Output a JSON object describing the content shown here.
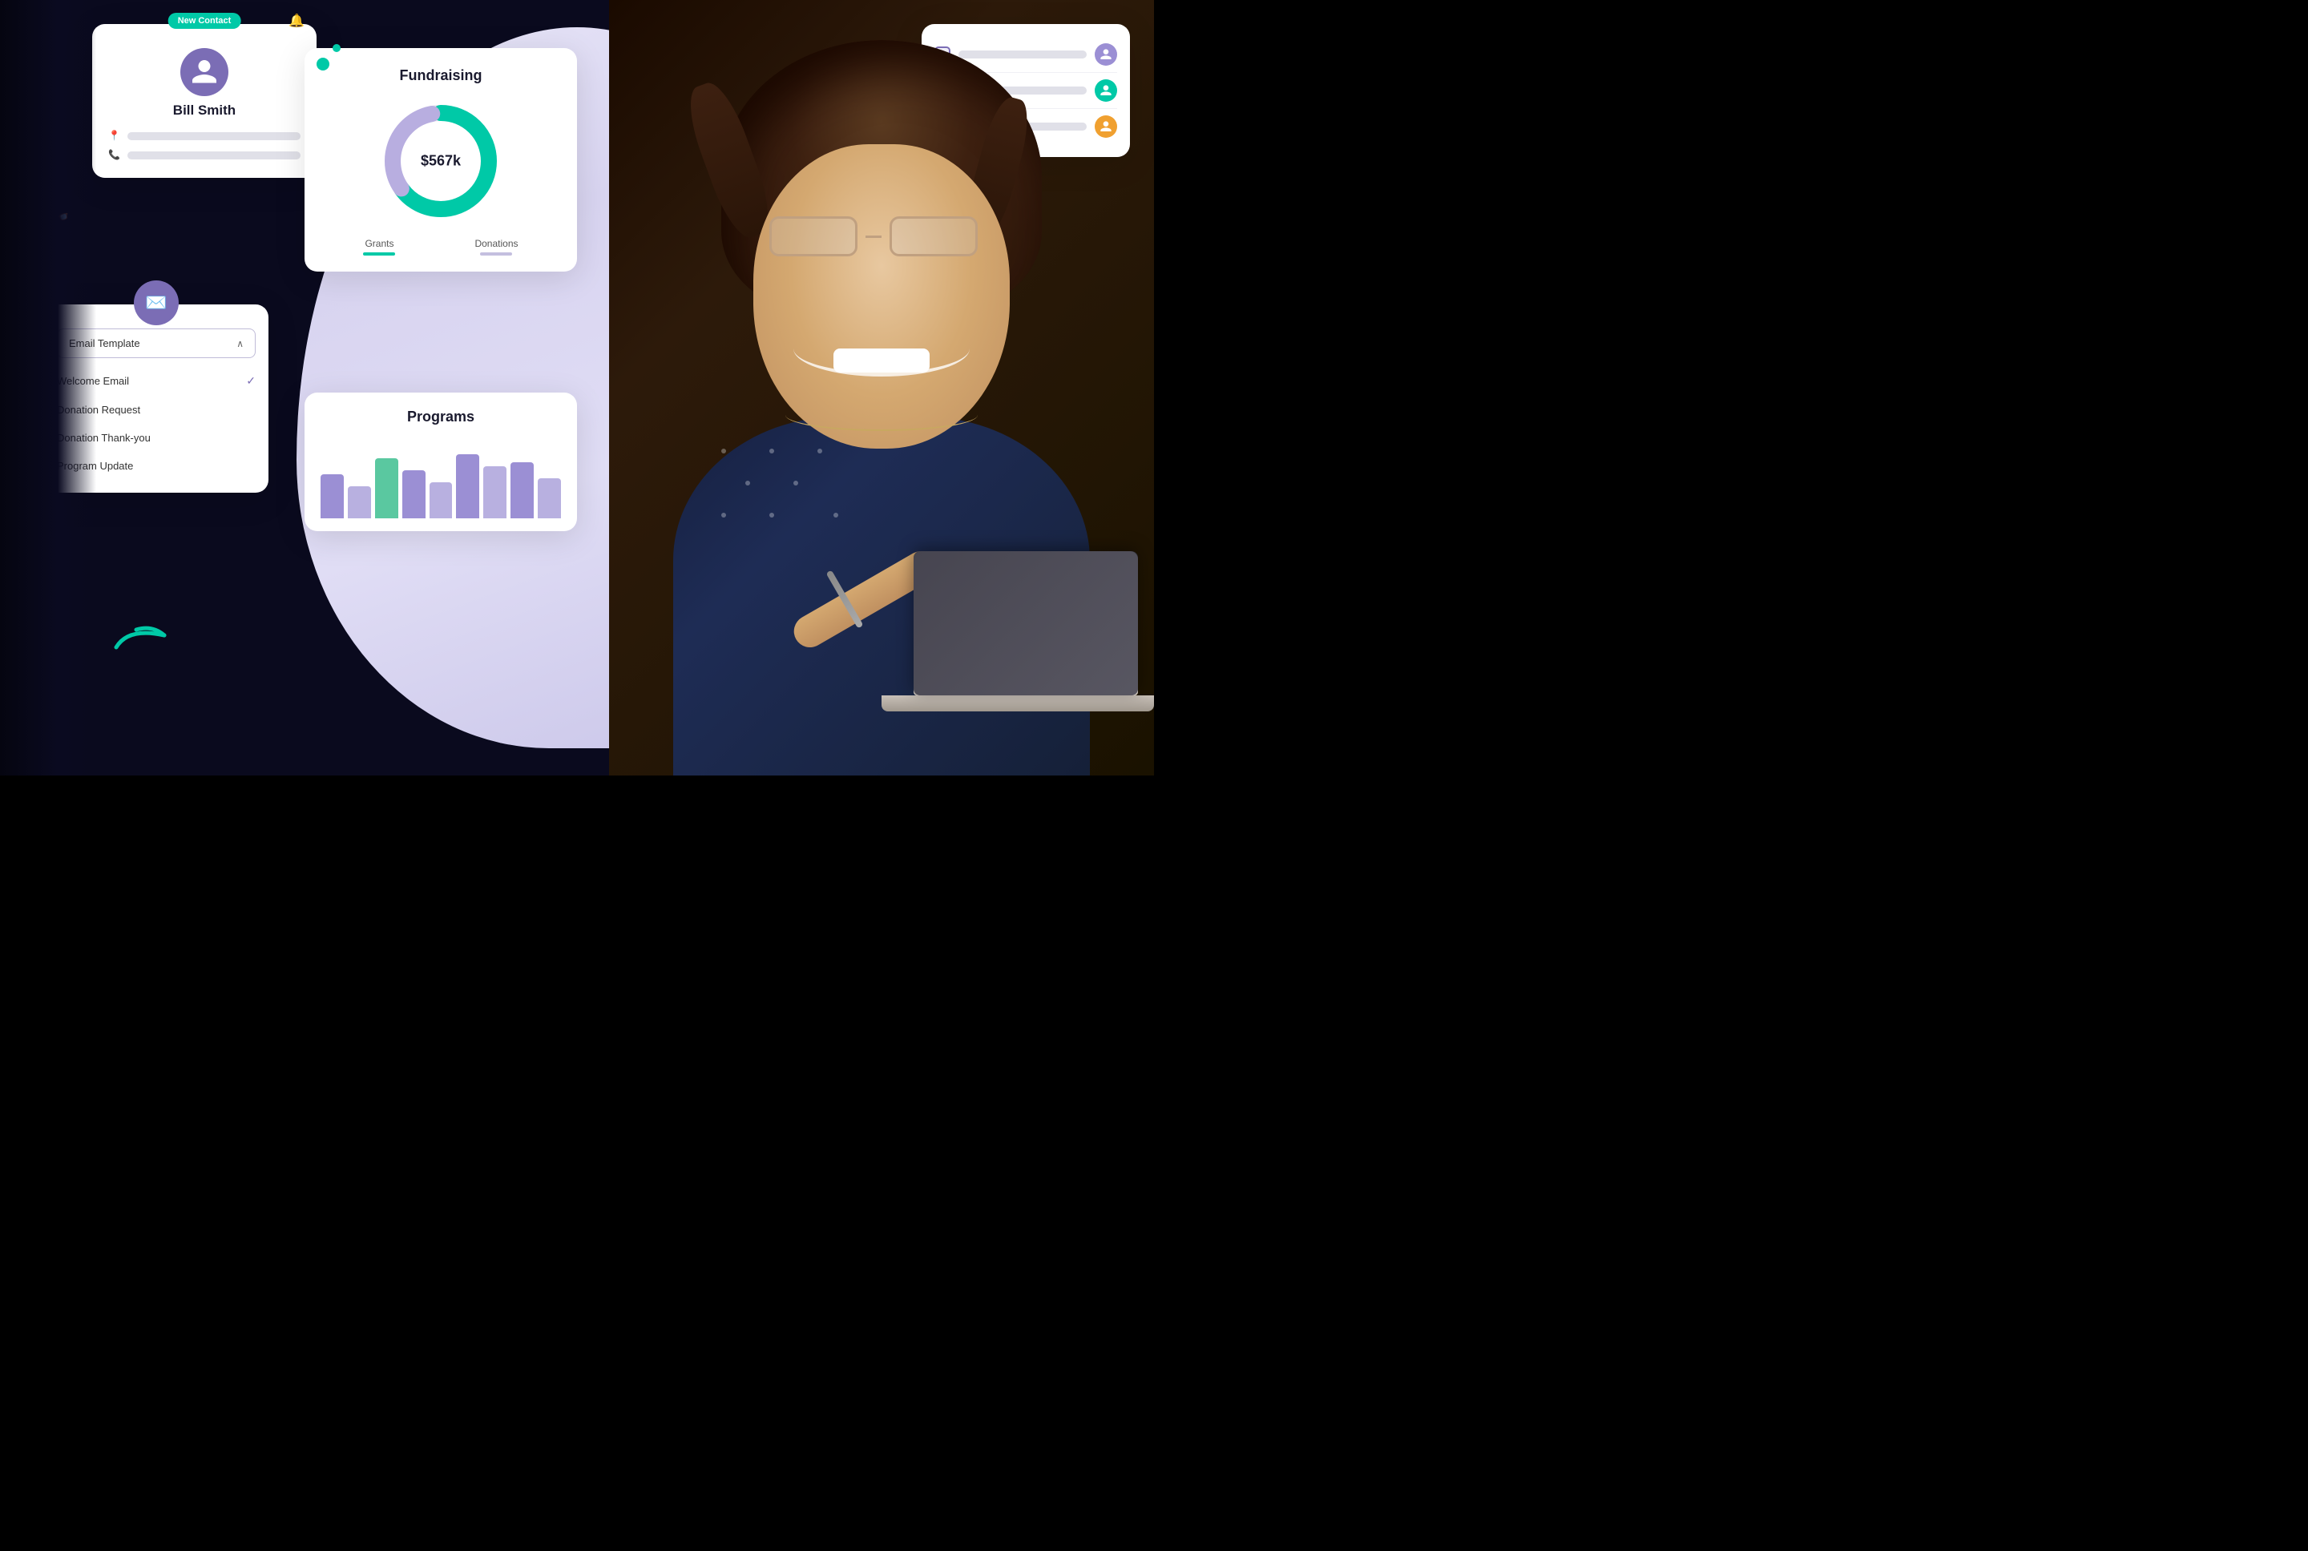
{
  "contact_card": {
    "badge": "New Contact",
    "name": "Bill Smith",
    "info_rows": [
      "address",
      "phone"
    ]
  },
  "email_card": {
    "dropdown_label": "Email Template",
    "items": [
      {
        "label": "Welcome Email",
        "selected": true
      },
      {
        "label": "Donation Request",
        "selected": false
      },
      {
        "label": "Donation Thank-you",
        "selected": false
      },
      {
        "label": "Program Update",
        "selected": false
      }
    ]
  },
  "fundraising_card": {
    "title": "Fundraising",
    "amount": "$567k",
    "grants_label": "Grants",
    "donations_label": "Donations",
    "donut": {
      "grants_pct": 65,
      "donations_pct": 35
    }
  },
  "programs_card": {
    "title": "Programs",
    "bars": [
      {
        "value": 55,
        "color": "#9b8fd4"
      },
      {
        "value": 40,
        "color": "#b8b0e0"
      },
      {
        "value": 75,
        "color": "#5ac8a0"
      },
      {
        "value": 60,
        "color": "#9b8fd4"
      },
      {
        "value": 45,
        "color": "#b8b0e0"
      },
      {
        "value": 80,
        "color": "#9b8fd4"
      },
      {
        "value": 65,
        "color": "#b8b0e0"
      },
      {
        "value": 70,
        "color": "#9b8fd4"
      },
      {
        "value": 50,
        "color": "#b8b0e0"
      }
    ]
  },
  "task_card": {
    "items": [
      {
        "checked": true,
        "avatar_color": "#9b8fd4"
      },
      {
        "checked": false,
        "avatar_color": "#00c9a7"
      },
      {
        "checked": false,
        "avatar_color": "#f0a030"
      }
    ]
  },
  "colors": {
    "primary_purple": "#7b6db5",
    "teal": "#00c9a7",
    "dark_bg": "#0a0a1a",
    "card_bg": "#ffffff",
    "text_dark": "#1a1a2e",
    "text_gray": "#888888"
  }
}
